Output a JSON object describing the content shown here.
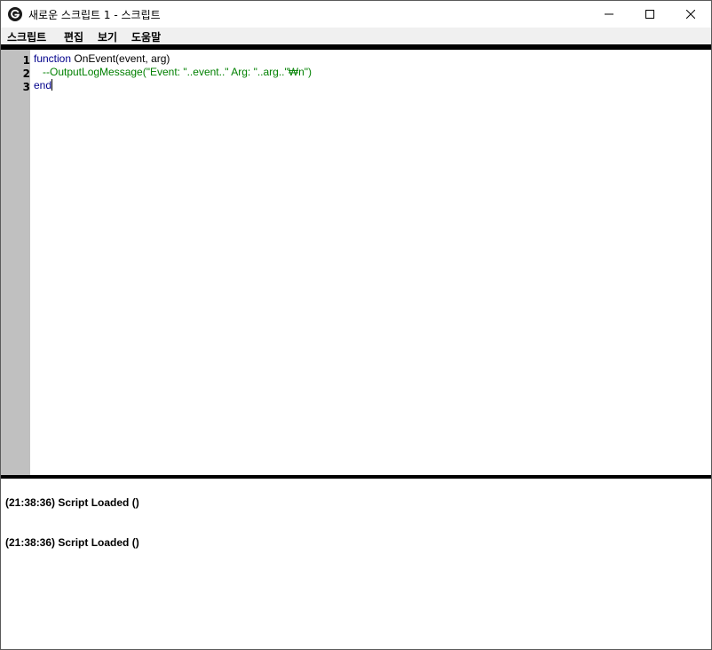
{
  "window": {
    "title": "새로운 스크립트 1 - 스크립트",
    "icon": "logitech-g-icon"
  },
  "menu": {
    "items": [
      "스크립트",
      "편집",
      "보기",
      "도움말"
    ]
  },
  "editor": {
    "line_numbers": [
      "1",
      "2",
      "3"
    ],
    "line1": {
      "keyword": "function",
      "rest": " OnEvent(event, arg)"
    },
    "line2": {
      "comment": "   --OutputLogMessage(\"Event: \"..event..\" Arg: \"..arg..\"₩n\")"
    },
    "line3": {
      "keyword": "end"
    }
  },
  "output": {
    "lines": [
      "(21:38:36) Script Loaded ()",
      "(21:38:36) Script Loaded ()"
    ]
  },
  "colors": {
    "keyword": "#00008b",
    "comment": "#008000",
    "gutter": "#c0c0c0",
    "menubar": "#f0f0f0"
  }
}
